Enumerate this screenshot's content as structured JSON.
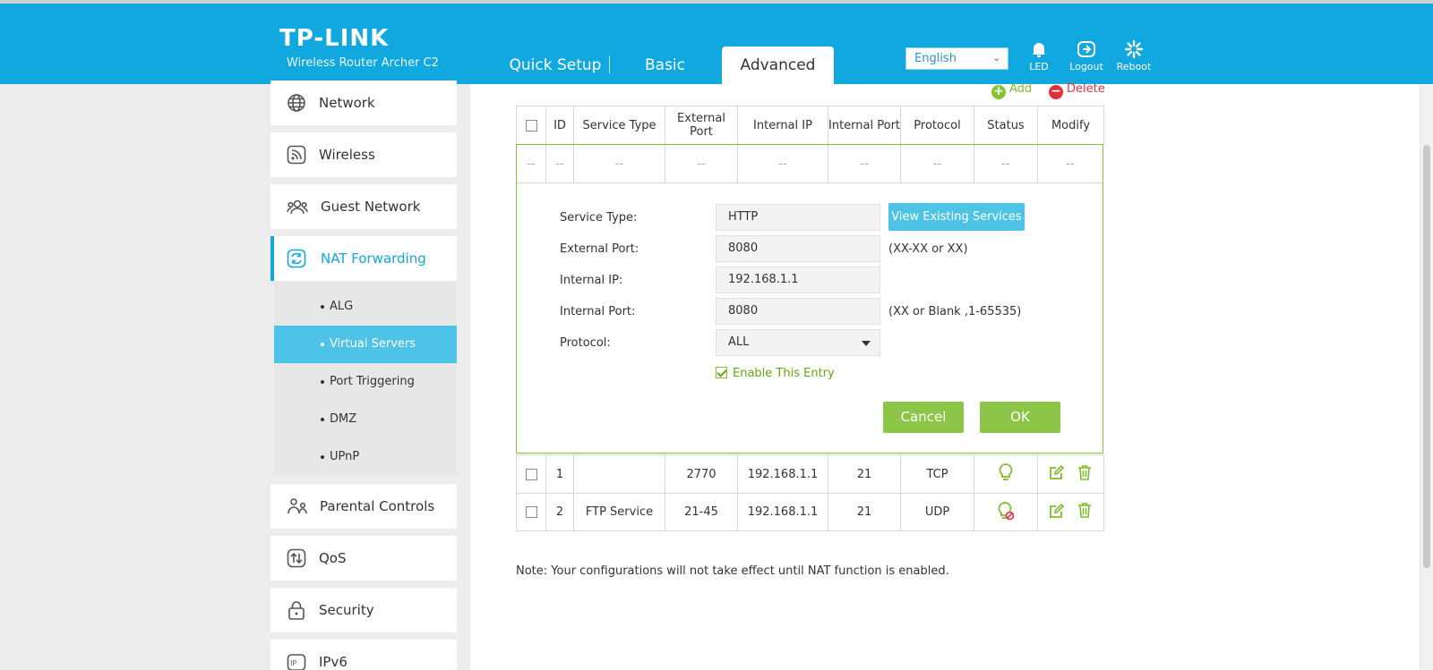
{
  "header": {
    "logo": "TP-LINK",
    "model": "Wireless Router Archer C2",
    "tabs": {
      "quick_setup": "Quick Setup",
      "basic": "Basic",
      "advanced": "Advanced"
    },
    "language": "English",
    "icons": {
      "led": "LED",
      "logout": "Logout",
      "reboot": "Reboot"
    }
  },
  "sidebar": {
    "network": "Network",
    "wireless": "Wireless",
    "guest_network": "Guest Network",
    "nat_forwarding": "NAT Forwarding",
    "sub": {
      "alg": "ALG",
      "virtual_servers": "Virtual Servers",
      "port_triggering": "Port Triggering",
      "dmz": "DMZ",
      "upnp": "UPnP"
    },
    "parental_controls": "Parental Controls",
    "qos": "QoS",
    "security": "Security",
    "ipv6": "IPv6"
  },
  "toolbar": {
    "add": "Add",
    "delete": "Delete"
  },
  "table": {
    "headers": {
      "id": "ID",
      "service_type": "Service Type",
      "external_port": "External Port",
      "internal_ip": "Internal IP",
      "internal_port": "Internal Port",
      "protocol": "Protocol",
      "status": "Status",
      "modify": "Modify"
    },
    "placeholder": "--",
    "rows": [
      {
        "id": "1",
        "service_type": "",
        "external_port": "2770",
        "internal_ip": "192.168.1.1",
        "internal_port": "21",
        "protocol": "TCP",
        "status": "enabled"
      },
      {
        "id": "2",
        "service_type": "FTP Service",
        "external_port": "21-45",
        "internal_ip": "192.168.1.1",
        "internal_port": "21",
        "protocol": "UDP",
        "status": "disabled"
      }
    ]
  },
  "form": {
    "service_type_label": "Service Type:",
    "service_type_value": "HTTP",
    "view_existing": "View Existing Services",
    "external_port_label": "External Port:",
    "external_port_value": "8080",
    "external_port_hint": "(XX-XX or XX)",
    "internal_ip_label": "Internal IP:",
    "internal_ip_value": "192.168.1.1",
    "internal_port_label": "Internal Port:",
    "internal_port_value": "8080",
    "internal_port_hint": "(XX or Blank ,1-65535)",
    "protocol_label": "Protocol:",
    "protocol_value": "ALL",
    "enable_label": "Enable This Entry",
    "cancel": "Cancel",
    "ok": "OK"
  },
  "note": "Note: Your configurations will not take effect until NAT function is enabled.",
  "colors": {
    "brand": "#11a7df",
    "accent_green": "#8dc548",
    "delete_red": "#e1303c",
    "active_sub": "#4ec3e8"
  }
}
